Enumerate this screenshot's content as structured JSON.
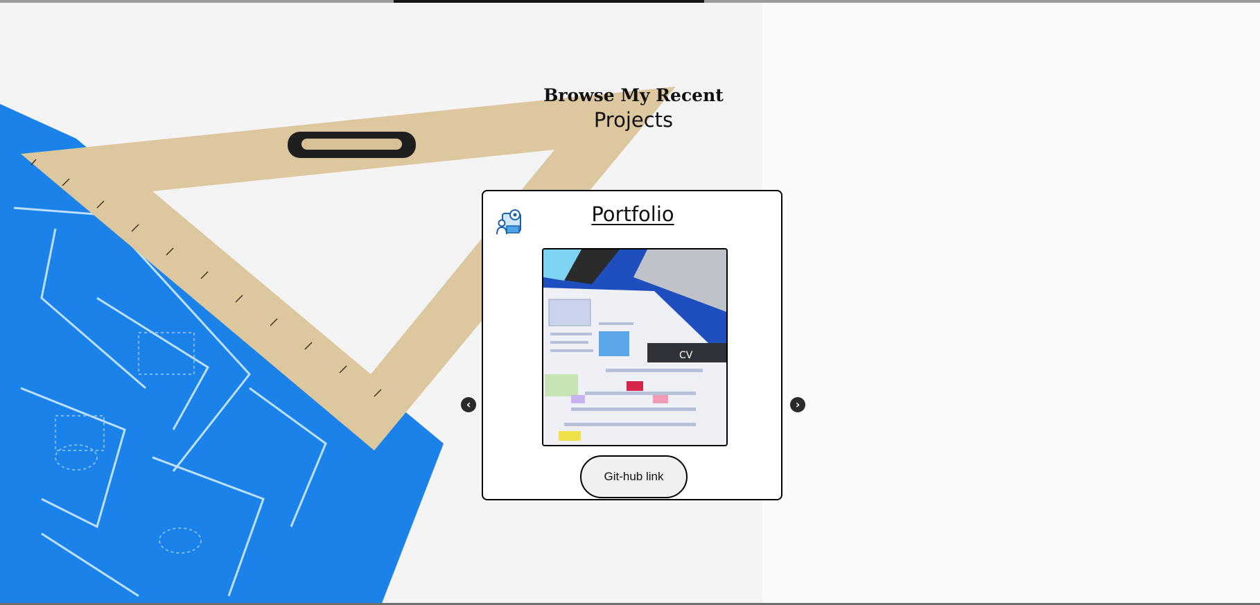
{
  "section": {
    "heading_line1": "Browse My Recent",
    "heading_line2": "Projects"
  },
  "carousel": {
    "prev_icon": "chevron-left-icon",
    "next_icon": "chevron-right-icon",
    "card": {
      "title": "Portfolio",
      "icon": "developer-gear-icon",
      "image_text": "CV",
      "button_label": "Git-hub link"
    }
  },
  "colors": {
    "blueprint": "#1a82e8",
    "ruler": "#dcc79e",
    "card_border": "#000000"
  }
}
